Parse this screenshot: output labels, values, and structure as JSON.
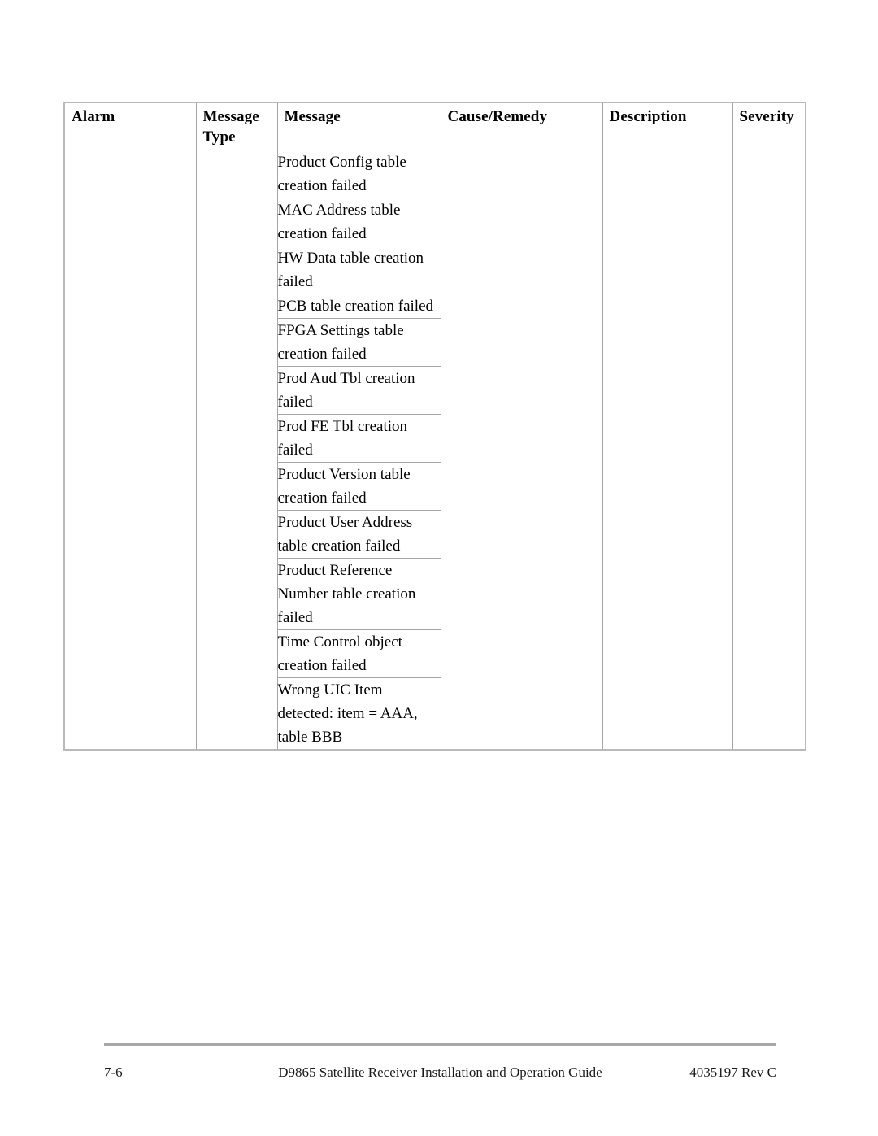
{
  "document": {
    "page_number": "7-6",
    "guide_title": "D9865 Satellite Receiver Installation and Operation Guide",
    "part_number": "4035197 Rev C"
  },
  "alarm_table": {
    "columns": [
      {
        "key": "alarm",
        "label": "Alarm"
      },
      {
        "key": "message_type",
        "label": "Message\nType"
      },
      {
        "key": "message",
        "label": "Message"
      },
      {
        "key": "cause_remedy",
        "label": "Cause/Remedy"
      },
      {
        "key": "description",
        "label": "Description"
      },
      {
        "key": "severity",
        "label": "Severity"
      }
    ],
    "header": {
      "alarm": "Alarm",
      "message_type_line1": "Message",
      "message_type_line2": "Type",
      "message": "Message",
      "cause_remedy": "Cause/Remedy",
      "description": "Description",
      "severity": "Severity"
    },
    "rows": [
      {
        "message": "Product Config table creation failed"
      },
      {
        "message": "MAC Address table creation failed"
      },
      {
        "message": "HW Data table creation failed"
      },
      {
        "message": "PCB table creation failed"
      },
      {
        "message": "FPGA Settings table creation failed"
      },
      {
        "message": "Prod Aud Tbl creation failed"
      },
      {
        "message": "Prod FE Tbl creation failed"
      },
      {
        "message": "Product Version table creation failed"
      },
      {
        "message": "Product User Address table creation failed"
      },
      {
        "message": "Product Reference Number table creation failed"
      },
      {
        "message": "Time Control object creation failed"
      },
      {
        "message": "Wrong UIC Item detected: item = AAA, table BBB"
      }
    ],
    "empty_cell_text": ""
  },
  "colors": {
    "page_background": "#ffffff",
    "text": "#000000",
    "border_outer": "#b9b9b9",
    "border_inner": "#a6a6a6",
    "border_header": "#8c8c8c",
    "footer_rule": "#a8a8a8"
  }
}
